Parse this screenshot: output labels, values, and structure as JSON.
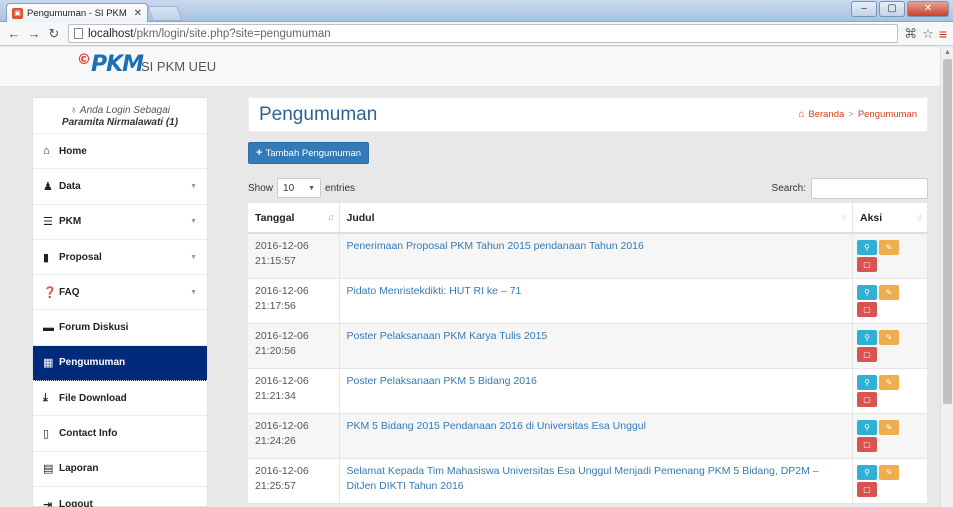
{
  "browser": {
    "tab_title": "Pengumuman - SI PKM U",
    "tab_close": "✕",
    "url_host": "localhost",
    "url_path": "/pkm/login/site.php?site=pengumuman"
  },
  "header": {
    "logo_text": "PKM",
    "brand": "SI PKM UEU"
  },
  "sidebar": {
    "login_label": "Anda Login Sebagai",
    "login_user": "Paramita Nirmalawati (1)",
    "items": [
      {
        "label": "Home",
        "icon": "home-icon"
      },
      {
        "label": "Data",
        "icon": "user-icon"
      },
      {
        "label": "PKM",
        "icon": "list-icon"
      },
      {
        "label": "Proposal",
        "icon": "book-icon"
      },
      {
        "label": "FAQ",
        "icon": "question-icon"
      },
      {
        "label": "Forum Diskusi",
        "icon": "comment-icon"
      },
      {
        "label": "Pengumuman",
        "icon": "grid-icon",
        "active": true
      },
      {
        "label": "File Download",
        "icon": "download-icon"
      },
      {
        "label": "Contact Info",
        "icon": "phone-icon"
      },
      {
        "label": "Laporan",
        "icon": "report-icon"
      },
      {
        "label": "Logout",
        "icon": "logout-icon"
      }
    ]
  },
  "main": {
    "title": "Pengumuman",
    "breadcrumb_home": "Beranda",
    "breadcrumb_sep": ">",
    "breadcrumb_current": "Pengumuman",
    "add_button": "Tambah Pengumuman",
    "show_label": "Show",
    "entries_value": "10",
    "entries_label": "entries",
    "search_label": "Search:"
  },
  "table": {
    "headers": [
      "Tanggal",
      "Judul",
      "Aksi"
    ],
    "rows": [
      {
        "date": "2016-12-06",
        "time": "21:15:57",
        "title": "Penerimaan Proposal PKM Tahun 2015 pendanaan Tahun 2016"
      },
      {
        "date": "2016-12-06",
        "time": "21:17:56",
        "title": "Pidato Menristekdikti: HUT RI ke – 71"
      },
      {
        "date": "2016-12-06",
        "time": "21:20:56",
        "title": "Poster Pelaksanaan PKM Karya Tulis 2015"
      },
      {
        "date": "2016-12-06",
        "time": "21:21:34",
        "title": "Poster Pelaksanaan PKM 5 Bidang 2016"
      },
      {
        "date": "2016-12-06",
        "time": "21:24:26",
        "title": "PKM 5 Bidang 2015 Pendanaan 2016 di Universitas Esa Unggul"
      },
      {
        "date": "2016-12-06",
        "time": "21:25:57",
        "title": "Selamat Kepada Tim Mahasiswa Universitas Esa Unggul Menjadi Pemenang PKM 5 Bidang, DP2M – DitJen DIKTI Tahun 2016"
      }
    ]
  },
  "colors": {
    "active_menu": "#002b7a",
    "primary": "#337ab7",
    "view_btn": "#31b0d5",
    "edit_btn": "#f0ad4e",
    "delete_btn": "#d9534f"
  }
}
